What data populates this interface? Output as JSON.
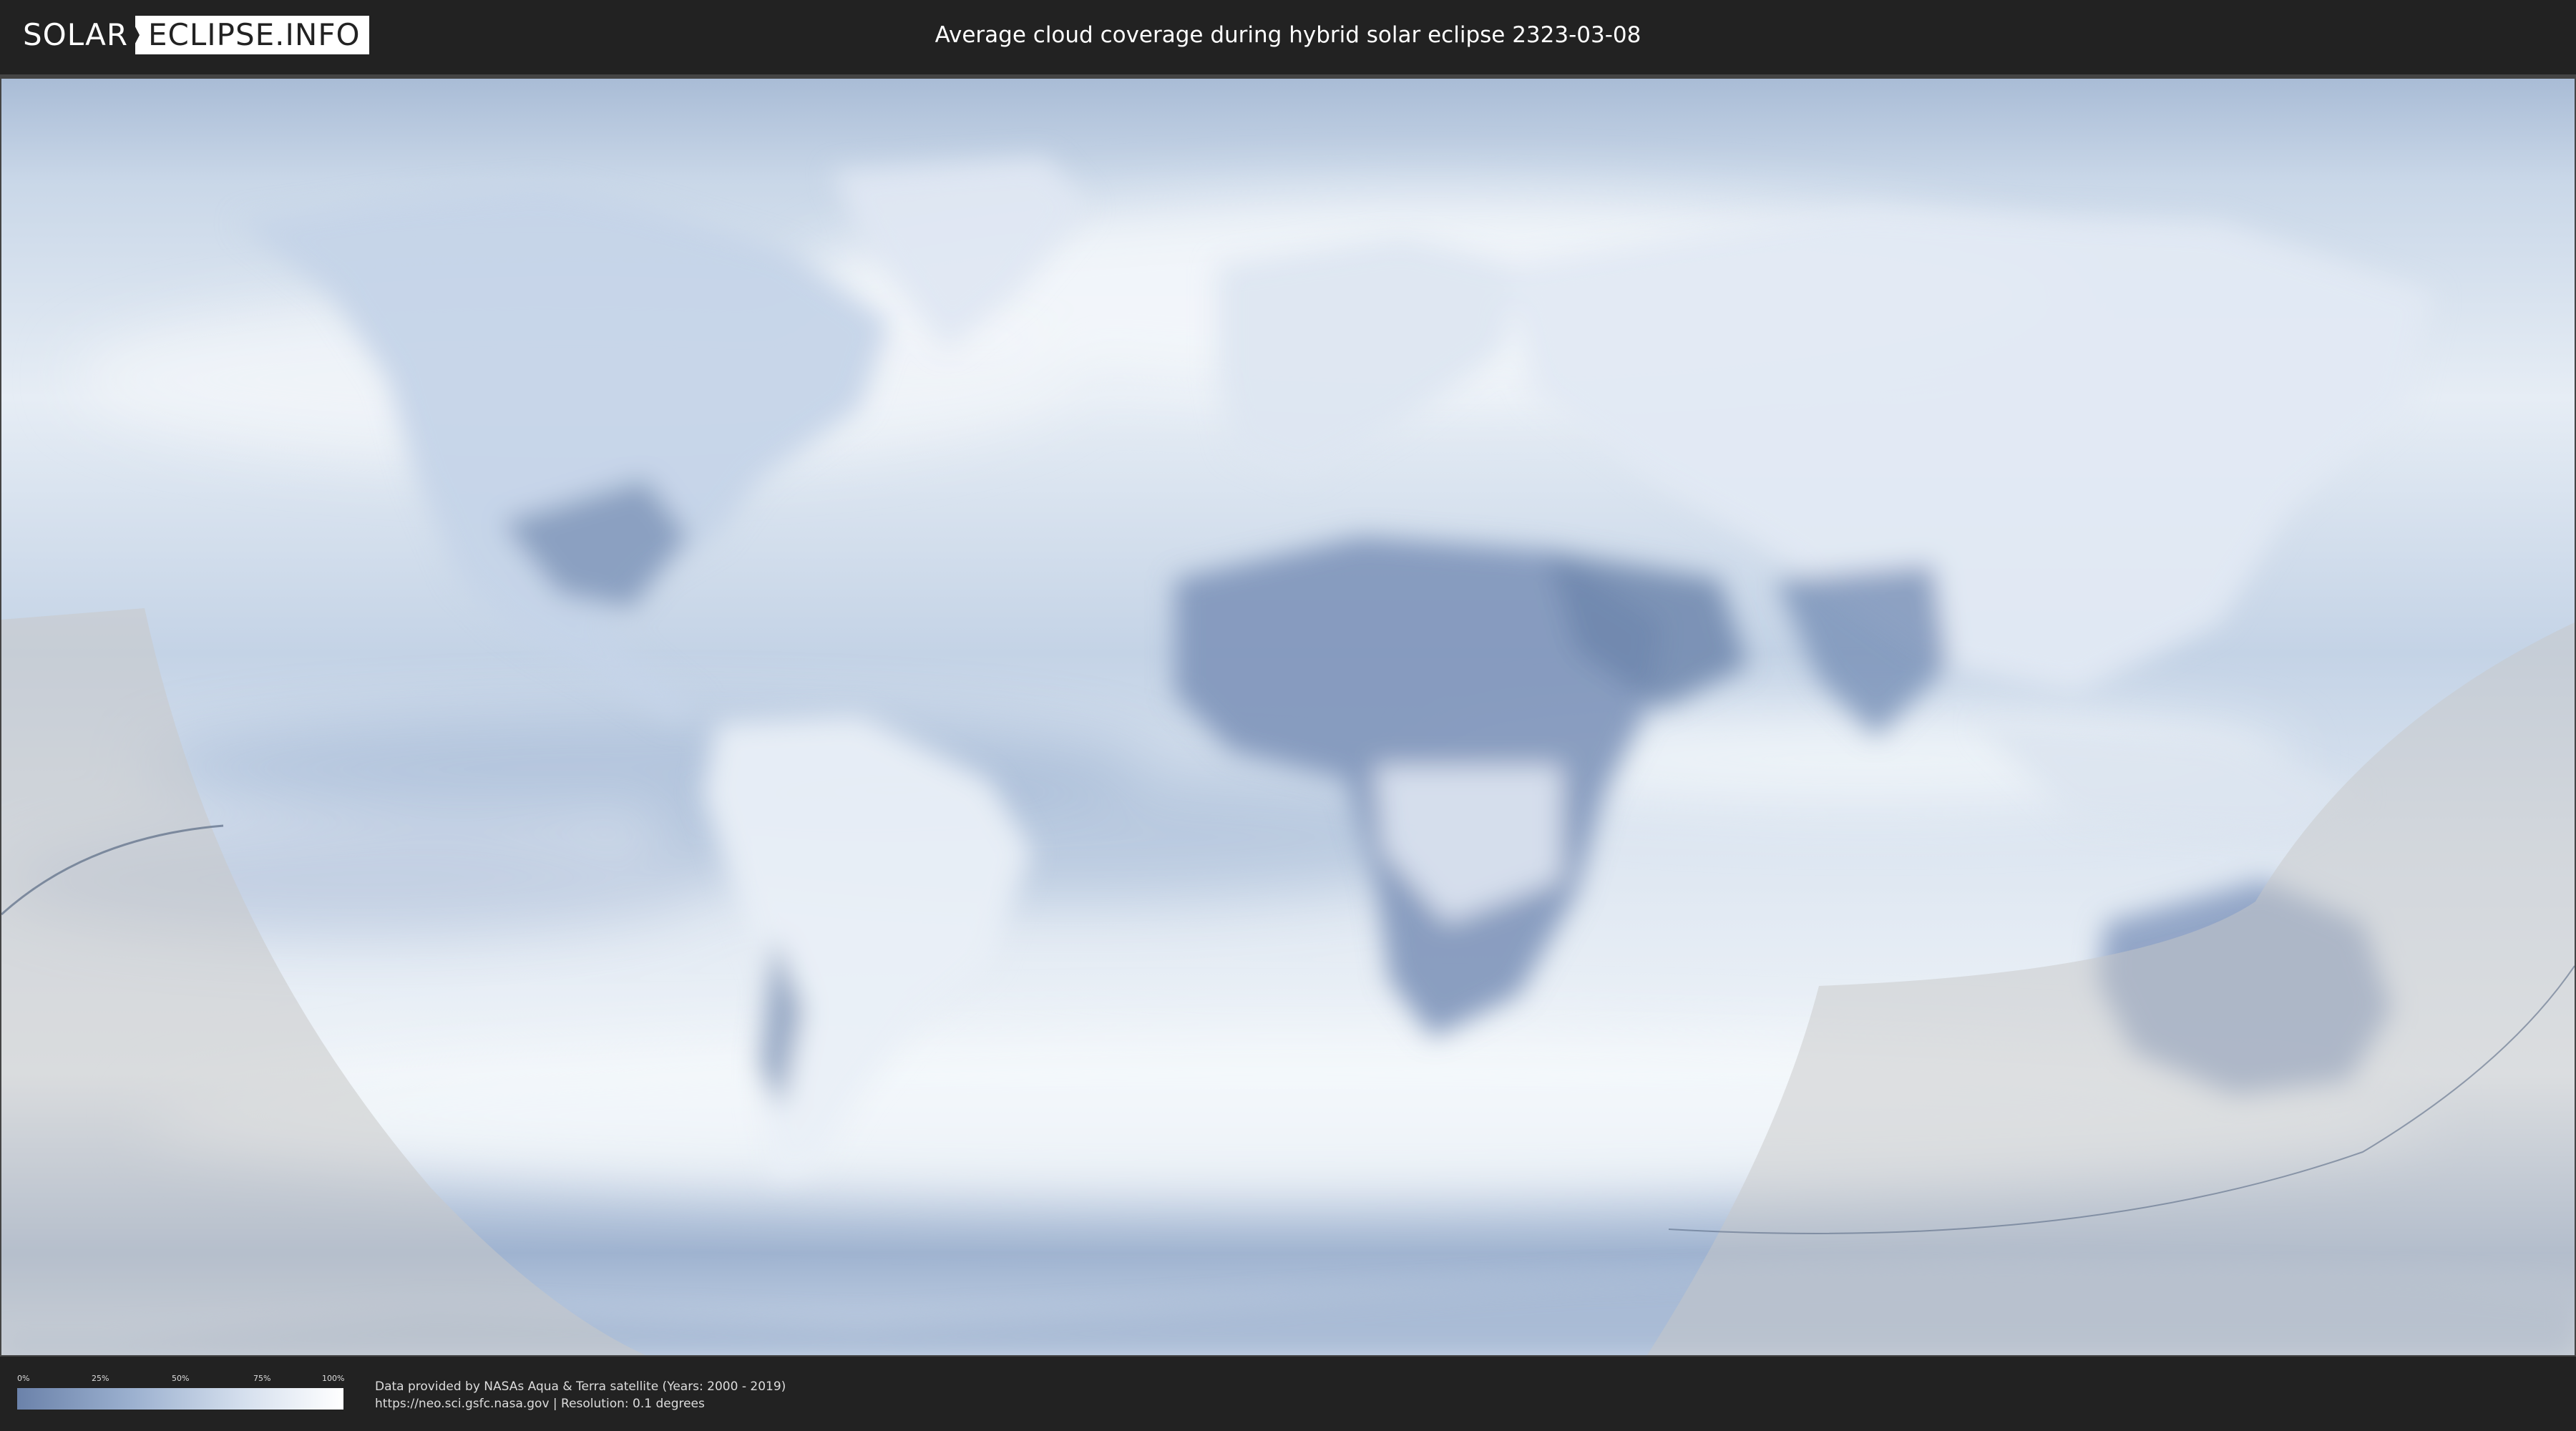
{
  "header": {
    "logo_left": "SOLAR",
    "logo_right": "ECLIPSE.INFO",
    "title": "Average cloud coverage during hybrid solar eclipse 2323-03-08"
  },
  "legend": {
    "ticks": [
      "0%",
      "25%",
      "50%",
      "75%",
      "100%"
    ],
    "tick_values": [
      0,
      25,
      50,
      75,
      100
    ],
    "gradient_colors": [
      "#6b82aa",
      "#9bb0cf",
      "#d6e0ee",
      "#ffffff"
    ]
  },
  "footer": {
    "credit_line_1": "Data provided by NASAs Aqua & Terra satellite (Years: 2000 - 2019)",
    "credit_line_2": "https://neo.sci.gsfc.nasa.gov | Resolution: 0.1 degrees"
  },
  "colors": {
    "background": "#222222",
    "clear_sky": "#6b82aa",
    "cloudy": "#ffffff",
    "night_overlay": "#bfbfbf"
  }
}
